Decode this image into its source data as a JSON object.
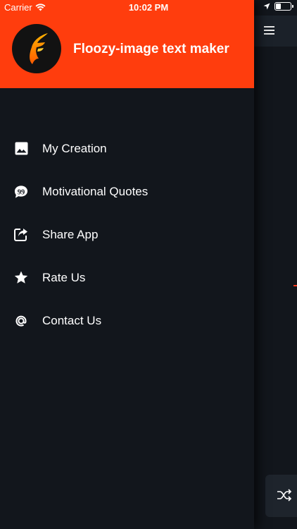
{
  "status_bar": {
    "carrier": "Carrier",
    "time": "10:02 PM",
    "battery_level": 0.3
  },
  "drawer": {
    "header_color": "#ff3d0d",
    "app_title": "Floozy-image text maker",
    "logo_icon": "flame-f-logo",
    "menu": [
      {
        "label": "My Creation",
        "icon": "image-icon"
      },
      {
        "label": "Motivational Quotes",
        "icon": "quote-bubble-icon"
      },
      {
        "label": "Share App",
        "icon": "share-icon"
      },
      {
        "label": "Rate Us",
        "icon": "star-icon"
      },
      {
        "label": "Contact Us",
        "icon": "at-icon"
      }
    ]
  },
  "background_app": {
    "menu_icon": "hamburger-icon",
    "shuffle_icon": "shuffle-icon"
  },
  "colors": {
    "background": "#12161c",
    "accent": "#ff3d0d"
  }
}
